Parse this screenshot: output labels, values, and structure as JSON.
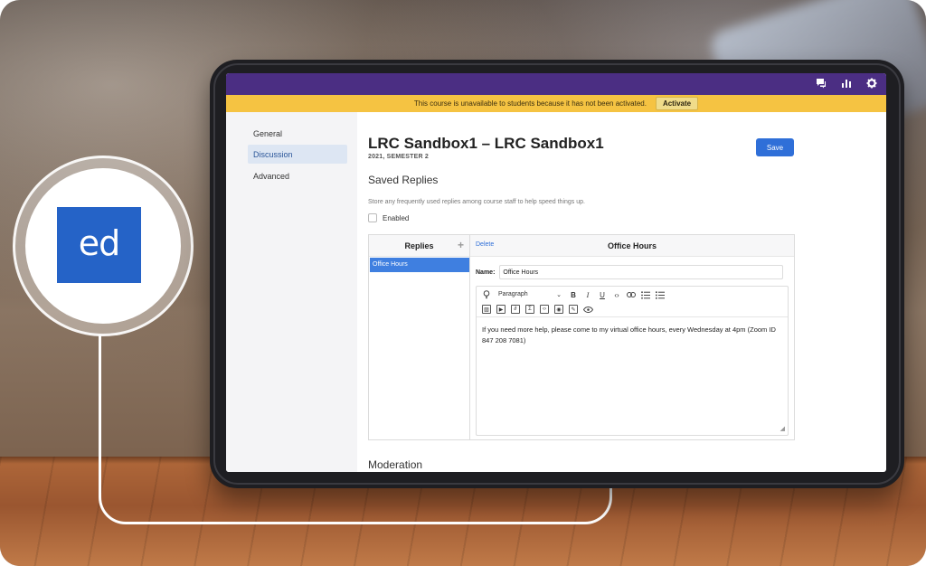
{
  "logo": {
    "text": "ed"
  },
  "topbar": {
    "icons": [
      "chat-icon",
      "stats-icon",
      "gear-icon"
    ]
  },
  "banner": {
    "message": "This course is unavailable to students because it has not been activated.",
    "activate_label": "Activate"
  },
  "sidebar": {
    "items": [
      {
        "label": "General"
      },
      {
        "label": "Discussion",
        "active": true
      },
      {
        "label": "Advanced"
      }
    ]
  },
  "course": {
    "title": "LRC Sandbox1 – LRC Sandbox1",
    "subtitle": "2021, SEMESTER 2",
    "save_label": "Save"
  },
  "saved_replies": {
    "heading": "Saved Replies",
    "description": "Store any frequently used replies among course staff to help speed things up.",
    "enabled_label": "Enabled",
    "list_header": "Replies",
    "add_symbol": "+",
    "items": [
      "Office Hours"
    ],
    "delete_label": "Delete",
    "editor_title": "Office Hours",
    "name_label": "Name:",
    "name_value": "Office Hours",
    "format_select": "Paragraph",
    "body_text": "If you need more help, please come to my virtual office hours, every Wednesday at 4pm (Zoom ID 847 208 7081)"
  },
  "moderation": {
    "heading": "Moderation"
  },
  "colors": {
    "topbar": "#4b2e83",
    "banner": "#f5c342",
    "accent": "#2f6fd8",
    "logo": "#2563c7"
  }
}
